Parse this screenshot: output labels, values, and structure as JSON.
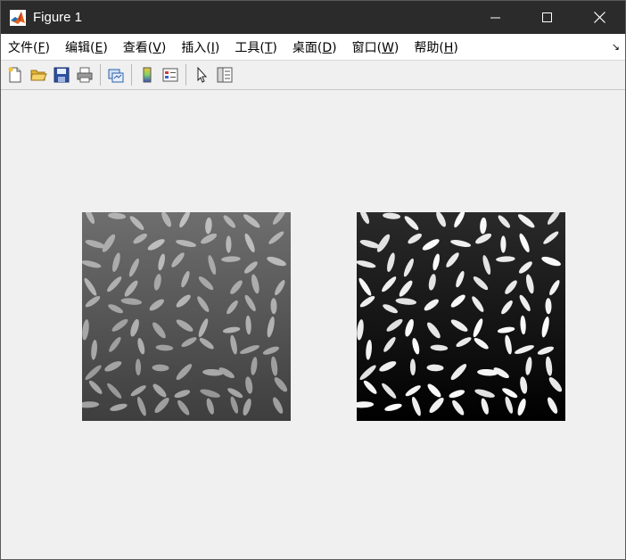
{
  "window": {
    "title": "Figure 1"
  },
  "menu": [
    {
      "label": "文件(",
      "key": "F",
      "suffix": ")"
    },
    {
      "label": "编辑(",
      "key": "E",
      "suffix": ")"
    },
    {
      "label": "查看(",
      "key": "V",
      "suffix": ")"
    },
    {
      "label": "插入(",
      "key": "I",
      "suffix": ")"
    },
    {
      "label": "工具(",
      "key": "T",
      "suffix": ")"
    },
    {
      "label": "桌面(",
      "key": "D",
      "suffix": ")"
    },
    {
      "label": "窗口(",
      "key": "W",
      "suffix": ")"
    },
    {
      "label": "帮助(",
      "key": "H",
      "suffix": ")"
    }
  ],
  "toolbar": {
    "icons": [
      "new-figure-icon",
      "open-file-icon",
      "save-icon",
      "print-icon",
      "link-plot-icon",
      "insert-colorbar-icon",
      "insert-legend-icon",
      "edit-plot-icon",
      "property-inspector-icon"
    ]
  },
  "images": [
    {
      "name": "original-rice-image",
      "style": "gray"
    },
    {
      "name": "enhanced-rice-image",
      "style": "contrast-stretched"
    }
  ],
  "colors": {
    "titlebar": "#2b2b2b",
    "menubar": "#ffffff",
    "background": "#f0f0f0"
  }
}
